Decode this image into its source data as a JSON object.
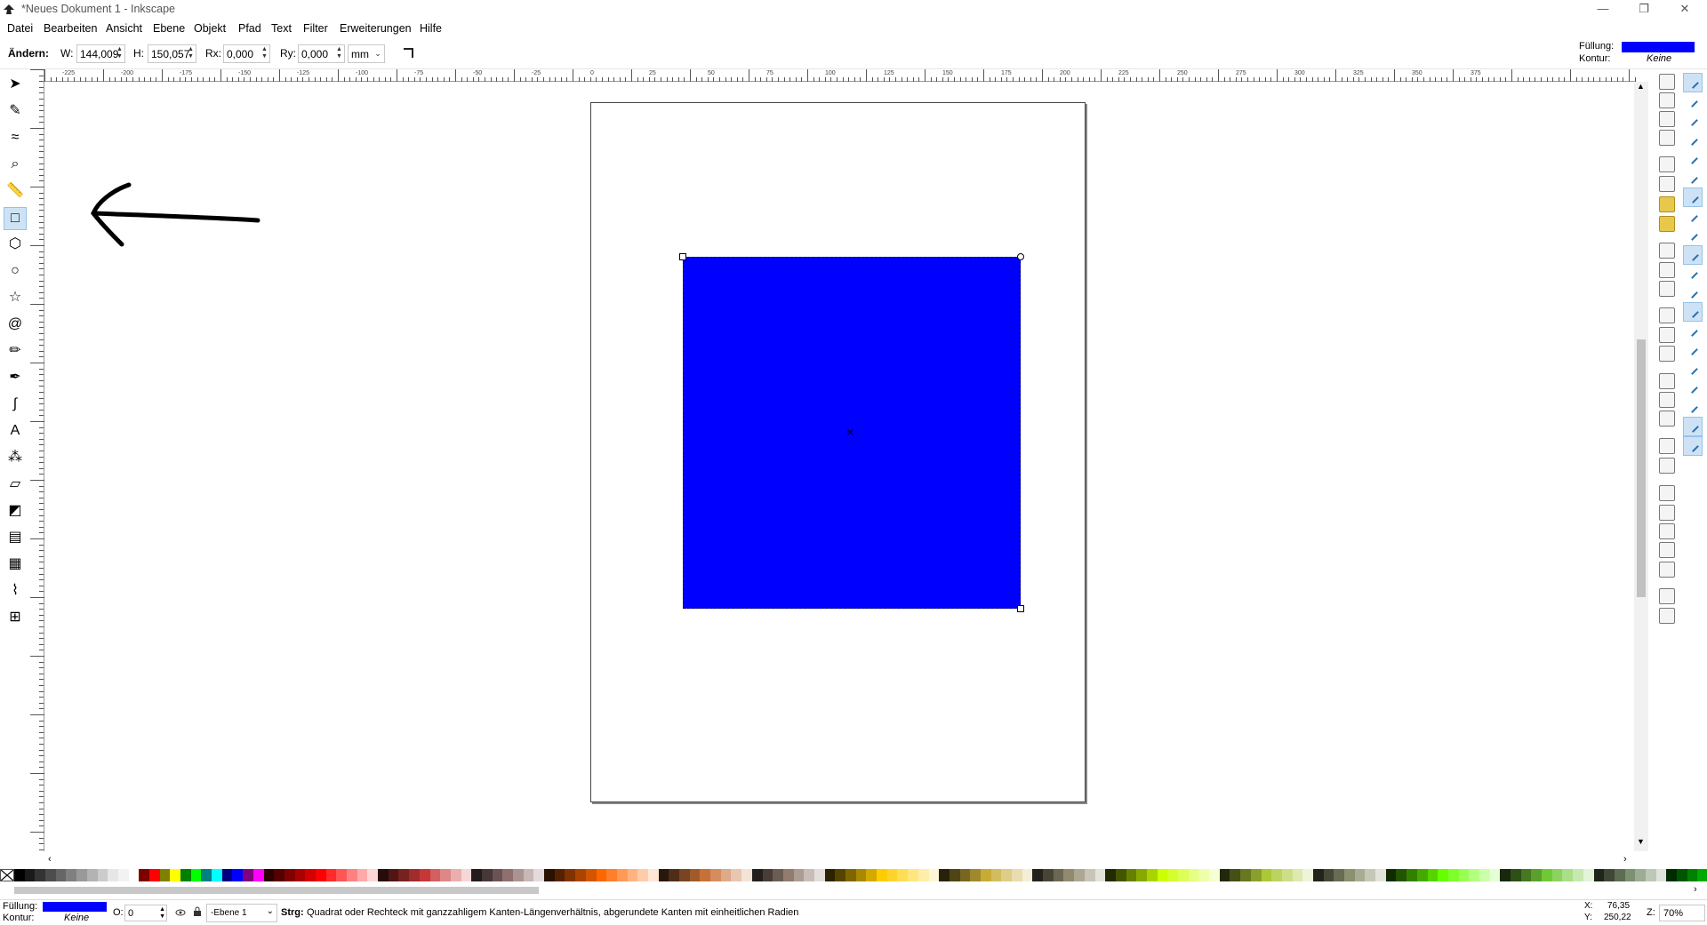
{
  "window": {
    "title": "*Neues Dokument 1 - Inkscape",
    "controls": [
      "—",
      "❐",
      "✕"
    ]
  },
  "menu": [
    "Datei",
    "Bearbeiten",
    "Ansicht",
    "Ebene",
    "Objekt",
    "Pfad",
    "Text",
    "Filter",
    "Erweiterungen",
    "Hilfe"
  ],
  "toolbar": {
    "change_label": "Ändern:",
    "w_label": "W:",
    "w_value": "144,009",
    "h_label": "H:",
    "h_value": "150,057",
    "rx_label": "Rx:",
    "rx_value": "0,000",
    "ry_label": "Ry:",
    "ry_value": "0,000",
    "unit": "mm"
  },
  "style_indicator": {
    "fill_label": "Füllung:",
    "stroke_label": "Kontur:",
    "stroke_value": "Keine",
    "fill_color": "#0000ff"
  },
  "ruler_labels": [
    "-225",
    "-200",
    "-175",
    "-150",
    "-125",
    "-100",
    "-75",
    "-50",
    "-25",
    "0",
    "25",
    "50",
    "75",
    "100",
    "125",
    "150",
    "175",
    "200",
    "225",
    "250",
    "275",
    "300",
    "325",
    "350",
    "375"
  ],
  "tools": [
    "selector-tool",
    "node-tool",
    "tweak-tool",
    "zoom-tool",
    "measure-tool",
    "rectangle-tool",
    "3dbox-tool",
    "ellipse-tool",
    "star-tool",
    "spiral-tool",
    "pencil-tool",
    "pen-tool",
    "calligraphy-tool",
    "text-tool",
    "spray-tool",
    "eraser-tool",
    "bucket-tool",
    "gradient-tool",
    "mesh-tool",
    "dropper-tool",
    "connector-tool"
  ],
  "active_tool": "rectangle-tool",
  "canvas": {
    "rect_fill": "#0000ff"
  },
  "palette": [
    "#000000",
    "#1a1a1a",
    "#333333",
    "#4d4d4d",
    "#666666",
    "#808080",
    "#999999",
    "#b3b3b3",
    "#cccccc",
    "#e6e6e6",
    "#f2f2f2",
    "#ffffff",
    "#800000",
    "#ff0000",
    "#808000",
    "#ffff00",
    "#008000",
    "#00ff00",
    "#008080",
    "#00ffff",
    "#000080",
    "#0000ff",
    "#800080",
    "#ff00ff",
    "#2b0000",
    "#550000",
    "#800000",
    "#aa0000",
    "#d40000",
    "#ff0000",
    "#ff2a2a",
    "#ff5555",
    "#ff8080",
    "#ffaaaa",
    "#ffd5d5",
    "#280b0b",
    "#501616",
    "#782121",
    "#a02c2c",
    "#c83737",
    "#d35f5f",
    "#de8787",
    "#e9afaf",
    "#f4d7d7",
    "#241c1c",
    "#483737",
    "#6c5353",
    "#916f6f",
    "#ac9393",
    "#c8b7b7",
    "#e3dbdb",
    "#2b1100",
    "#552200",
    "#803300",
    "#aa4400",
    "#d45500",
    "#ff6600",
    "#ff7f2a",
    "#ff9955",
    "#ffb380",
    "#ffccaa",
    "#ffe6d5",
    "#28170b",
    "#502d16",
    "#784421",
    "#a05a2c",
    "#c87137",
    "#d38d5f",
    "#deaa87",
    "#e9c6af",
    "#f4e3d7",
    "#241f1c",
    "#483e37",
    "#6c5d53",
    "#917c6f",
    "#ac9d93",
    "#c8beb7",
    "#e3dedb",
    "#2b2200",
    "#554400",
    "#806600",
    "#aa8800",
    "#d4aa00",
    "#ffcc00",
    "#ffd42a",
    "#ffdd55",
    "#ffe680",
    "#ffeeaa",
    "#fff6d5",
    "#28220b",
    "#504416",
    "#786721",
    "#a0892c",
    "#c8ab37",
    "#d3bc5f",
    "#decd87",
    "#e9ddaf",
    "#f4eed7",
    "#24221c",
    "#484537",
    "#6c6753",
    "#918a6f",
    "#aca793",
    "#c8c4b7",
    "#e3e2db",
    "#222b00",
    "#445500",
    "#668000",
    "#88aa00",
    "#aad400",
    "#ccff00",
    "#d4ff2a",
    "#ddff55",
    "#e5ff80",
    "#eeffaa",
    "#f6ffd5",
    "#22280b",
    "#445016",
    "#677821",
    "#89a02c",
    "#abc837",
    "#bcd35f",
    "#cdde87",
    "#dde9af",
    "#eef4d7",
    "#22241c",
    "#454837",
    "#676c53",
    "#8a916f",
    "#a7ac93",
    "#c4c8b7",
    "#e2e3db",
    "#112b00",
    "#225500",
    "#338000",
    "#44aa00",
    "#55d400",
    "#66ff00",
    "#7fff2a",
    "#99ff55",
    "#b3ff80",
    "#ccffaa",
    "#e5ffd5",
    "#17280b",
    "#2d5016",
    "#447821",
    "#5aa02c",
    "#71c837",
    "#8dd35f",
    "#aade87",
    "#c6e9af",
    "#e3f4d7",
    "#1f241c",
    "#3e4837",
    "#5d6c53",
    "#7c916f",
    "#9dac93",
    "#bec8b7",
    "#dee3db",
    "#002b00",
    "#005500",
    "#008000",
    "#00aa00"
  ],
  "status": {
    "fill_label": "Füllung:",
    "stroke_label": "Kontur:",
    "stroke_value": "Keine",
    "opacity_label": "O:",
    "opacity_value": "0",
    "layer": "-Ebene 1",
    "hint_bold": "Strg:",
    "hint": "Quadrat oder Rechteck mit ganzzahligem Kanten-Längenverhältnis, abgerundete Kanten mit einheitlichen Radien",
    "x_label": "X:",
    "x_value": "76,35",
    "y_label": "Y:",
    "y_value": "250,22",
    "zoom_label": "Z:",
    "zoom_value": "70%"
  }
}
